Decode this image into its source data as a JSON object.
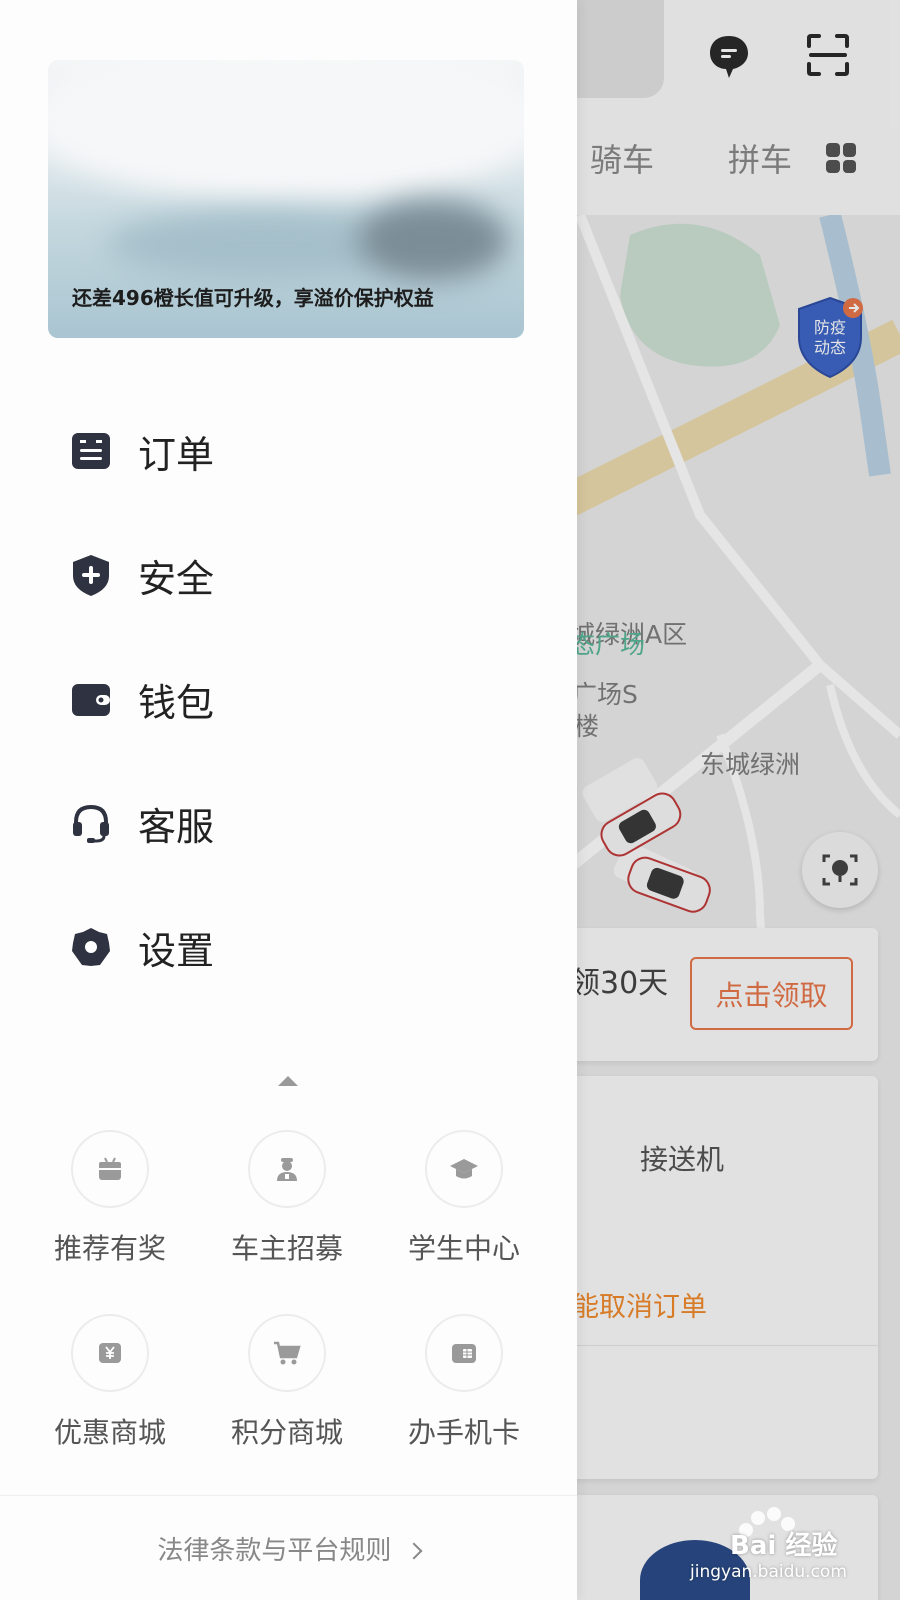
{
  "background_app": {
    "tabs": [
      "骑车",
      "拼车"
    ],
    "top_icons": [
      "message-bubble-icon",
      "scan-icon",
      "grid-menu-icon"
    ],
    "map_labels": [
      "城绿洲A区",
      "态广场",
      "广场S",
      "楼",
      "东城绿洲"
    ],
    "badge": {
      "line1": "防疫",
      "line2": "动态"
    },
    "promo": {
      "text": "领30天",
      "button": "点击领取"
    },
    "service_card": {
      "title": "接送机",
      "link": "能取消订单"
    }
  },
  "drawer": {
    "profile": {
      "upgrade_text": "还差496橙长值可升级，享溢价保护权益"
    },
    "menu": [
      {
        "label": "订单",
        "icon": "order-icon"
      },
      {
        "label": "安全",
        "icon": "safety-shield-icon"
      },
      {
        "label": "钱包",
        "icon": "wallet-icon"
      },
      {
        "label": "客服",
        "icon": "headset-icon"
      },
      {
        "label": "设置",
        "icon": "settings-gear-icon"
      }
    ],
    "services": [
      {
        "label": "推荐有奖",
        "icon": "gift-icon"
      },
      {
        "label": "车主招募",
        "icon": "driver-icon"
      },
      {
        "label": "学生中心",
        "icon": "graduation-cap-icon"
      },
      {
        "label": "优惠商城",
        "icon": "yuan-icon"
      },
      {
        "label": "积分商城",
        "icon": "cart-icon"
      },
      {
        "label": "办手机卡",
        "icon": "sim-card-icon"
      }
    ],
    "footer_link": "法律条款与平台规则"
  },
  "watermark": {
    "brand": "Bai 经验",
    "url": "jingyan.baidu.com"
  },
  "colors": {
    "accent_orange": "#e8774b",
    "menu_icon": "#2f3240",
    "text_dark": "#222222",
    "text_gray": "#555555"
  }
}
